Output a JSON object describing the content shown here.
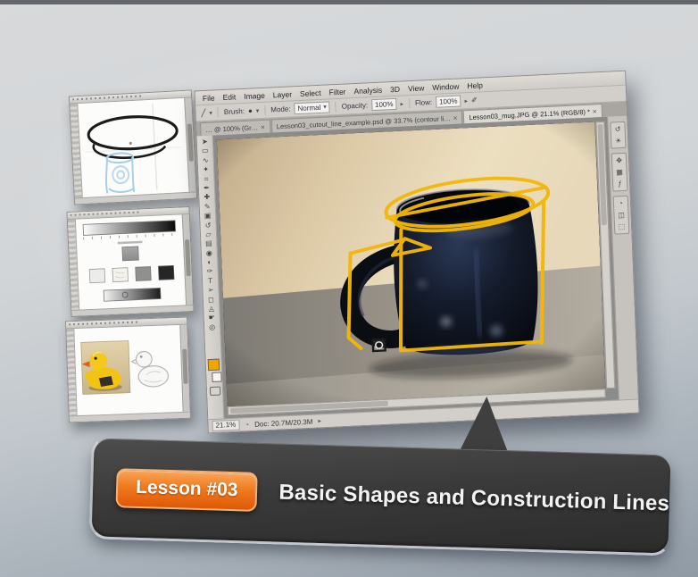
{
  "banner": {
    "badge": "Lesson #03",
    "title": "Basic Shapes and Construction Lines"
  },
  "photoshop": {
    "menu": [
      "File",
      "Edit",
      "Image",
      "Layer",
      "Select",
      "Filter",
      "Analysis",
      "3D",
      "View",
      "Window",
      "Help"
    ],
    "options": {
      "brush_label": "Brush:",
      "mode_label": "Mode:",
      "mode_value": "Normal",
      "opacity_label": "Opacity:",
      "opacity_value": "100%",
      "flow_label": "Flow:",
      "flow_value": "100%"
    },
    "tabs": [
      {
        "label": "… @ 100% (Gr…",
        "active": false
      },
      {
        "label": "Lesson03_cutout_line_example.psd @ 33.7% (contour li…",
        "active": false
      },
      {
        "label": "Lesson03_mug.JPG @ 21.1% (RGB/8) *",
        "active": true
      }
    ],
    "status": {
      "zoom": "21.1%",
      "doc": "Doc: 20.7M/20.3M"
    },
    "tools": [
      {
        "name": "move-tool-icon",
        "glyph": "➤"
      },
      {
        "name": "marquee-tool-icon",
        "glyph": "▭"
      },
      {
        "name": "lasso-tool-icon",
        "glyph": "∿"
      },
      {
        "name": "quick-select-tool-icon",
        "glyph": "✦"
      },
      {
        "name": "crop-tool-icon",
        "glyph": "⌗"
      },
      {
        "name": "eyedropper-tool-icon",
        "glyph": "✒"
      },
      {
        "name": "healing-brush-tool-icon",
        "glyph": "✚"
      },
      {
        "name": "brush-tool-icon",
        "glyph": "✎"
      },
      {
        "name": "clone-stamp-tool-icon",
        "glyph": "▣"
      },
      {
        "name": "history-brush-tool-icon",
        "glyph": "↺"
      },
      {
        "name": "eraser-tool-icon",
        "glyph": "▱"
      },
      {
        "name": "gradient-tool-icon",
        "glyph": "▤"
      },
      {
        "name": "blur-tool-icon",
        "glyph": "◉"
      },
      {
        "name": "dodge-tool-icon",
        "glyph": "◐"
      },
      {
        "name": "pen-tool-icon",
        "glyph": "✑"
      },
      {
        "name": "type-tool-icon",
        "glyph": "T"
      },
      {
        "name": "path-select-tool-icon",
        "glyph": "➢"
      },
      {
        "name": "shape-tool-icon",
        "glyph": "◻"
      },
      {
        "name": "3d-rotate-tool-icon",
        "glyph": "◬"
      },
      {
        "name": "hand-tool-icon",
        "glyph": "☛"
      },
      {
        "name": "zoom-tool-icon",
        "glyph": "◎"
      }
    ],
    "dock": [
      [
        {
          "name": "history-panel-icon",
          "glyph": "↺"
        },
        {
          "name": "info-panel-icon",
          "glyph": "☀"
        }
      ],
      [
        {
          "name": "color-panel-icon",
          "glyph": "✥"
        },
        {
          "name": "swatches-panel-icon",
          "glyph": "▦"
        },
        {
          "name": "styles-panel-icon",
          "glyph": "ƒ"
        }
      ],
      [
        {
          "name": "adjustments-panel-icon",
          "glyph": "◔"
        },
        {
          "name": "masks-panel-icon",
          "glyph": "◫"
        },
        {
          "name": "layers-panel-icon",
          "glyph": "⬚"
        }
      ]
    ]
  },
  "icons": {
    "dropdown": "▾",
    "flyout": "▸",
    "close": "×",
    "brush_preset": "╱",
    "brush_tip": "●",
    "airbrush": "✐",
    "status": "◔"
  },
  "colors": {
    "accent_orange": "#ec6608",
    "construction_yellow": "#f3b70a",
    "banner_dark": "#3a3a3a",
    "foreground_swatch": "#f2a400"
  }
}
